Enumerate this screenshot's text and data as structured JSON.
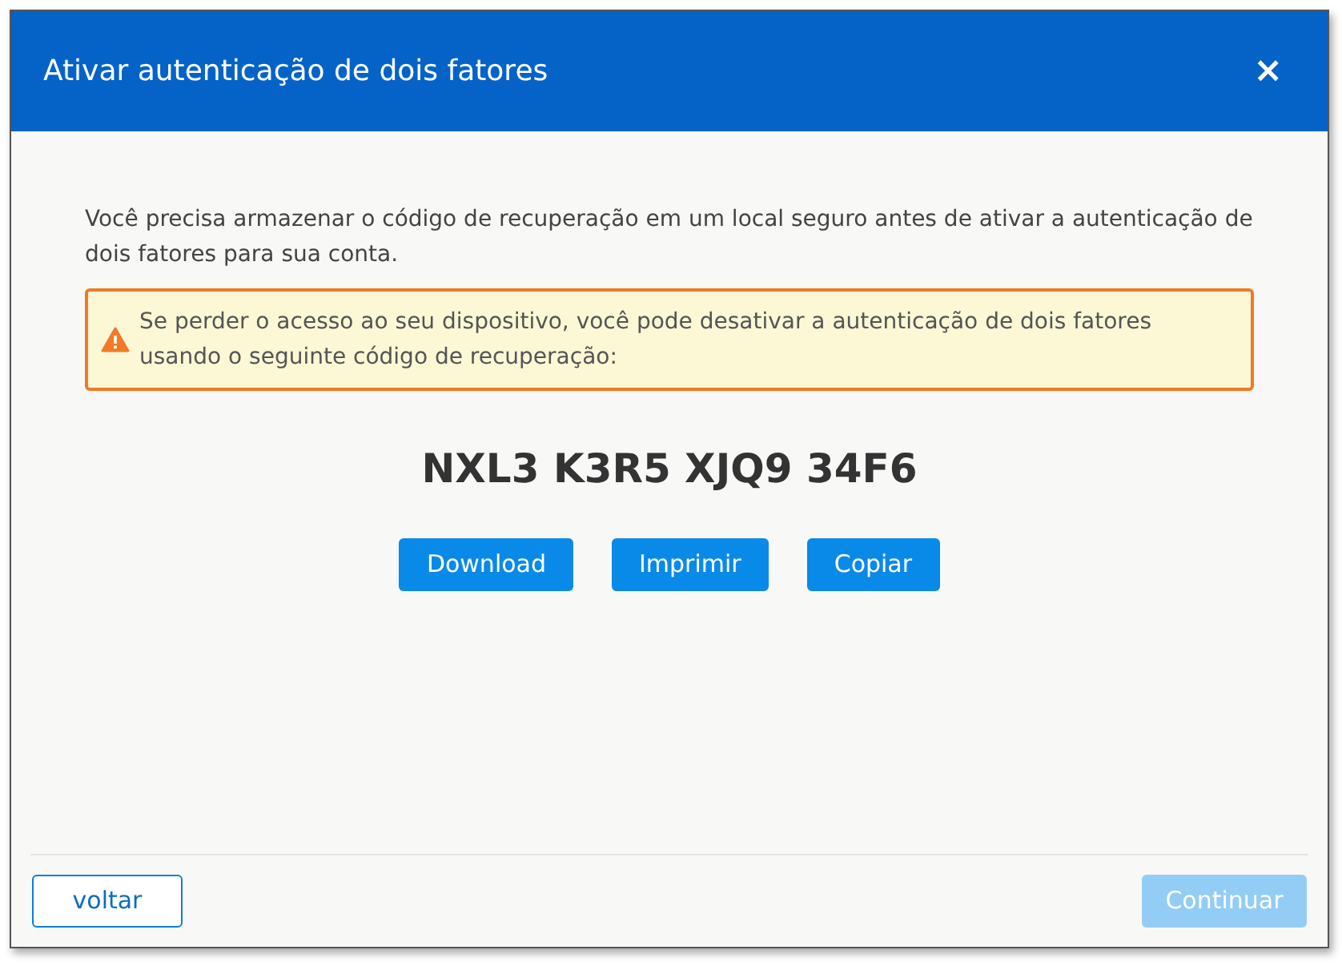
{
  "dialog": {
    "title": "Ativar autenticação de dois fatores",
    "close": "×"
  },
  "intro": "Você precisa armazenar o código de recuperação em um local seguro antes de ativar a autenticação de dois fatores para sua conta.",
  "warning": "Se perder o acesso ao seu dispositivo, você pode desativar a autenticação de dois fatores usando o seguinte código de recuperação:",
  "recovery_code": "NXL3 K3R5 XJQ9 34F6",
  "actions": [
    {
      "label": "Download"
    },
    {
      "label": "Imprimir"
    },
    {
      "label": "Copiar"
    }
  ],
  "footer": {
    "back": {
      "label": "voltar"
    },
    "continue": {
      "label": "Continuar",
      "disabled": true
    }
  }
}
